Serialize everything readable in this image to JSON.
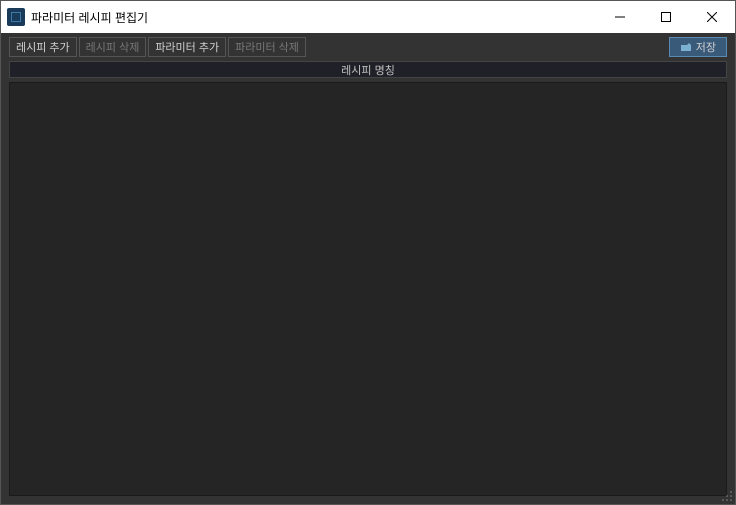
{
  "window": {
    "title": "파라미터 레시피 편집기"
  },
  "toolbar": {
    "recipe_add": "레시피 추가",
    "recipe_delete": "레시피 삭제",
    "param_add": "파라미터 추가",
    "param_delete": "파라미터 삭제",
    "save": "저장"
  },
  "header": {
    "recipe_name": "레시피 명칭"
  }
}
